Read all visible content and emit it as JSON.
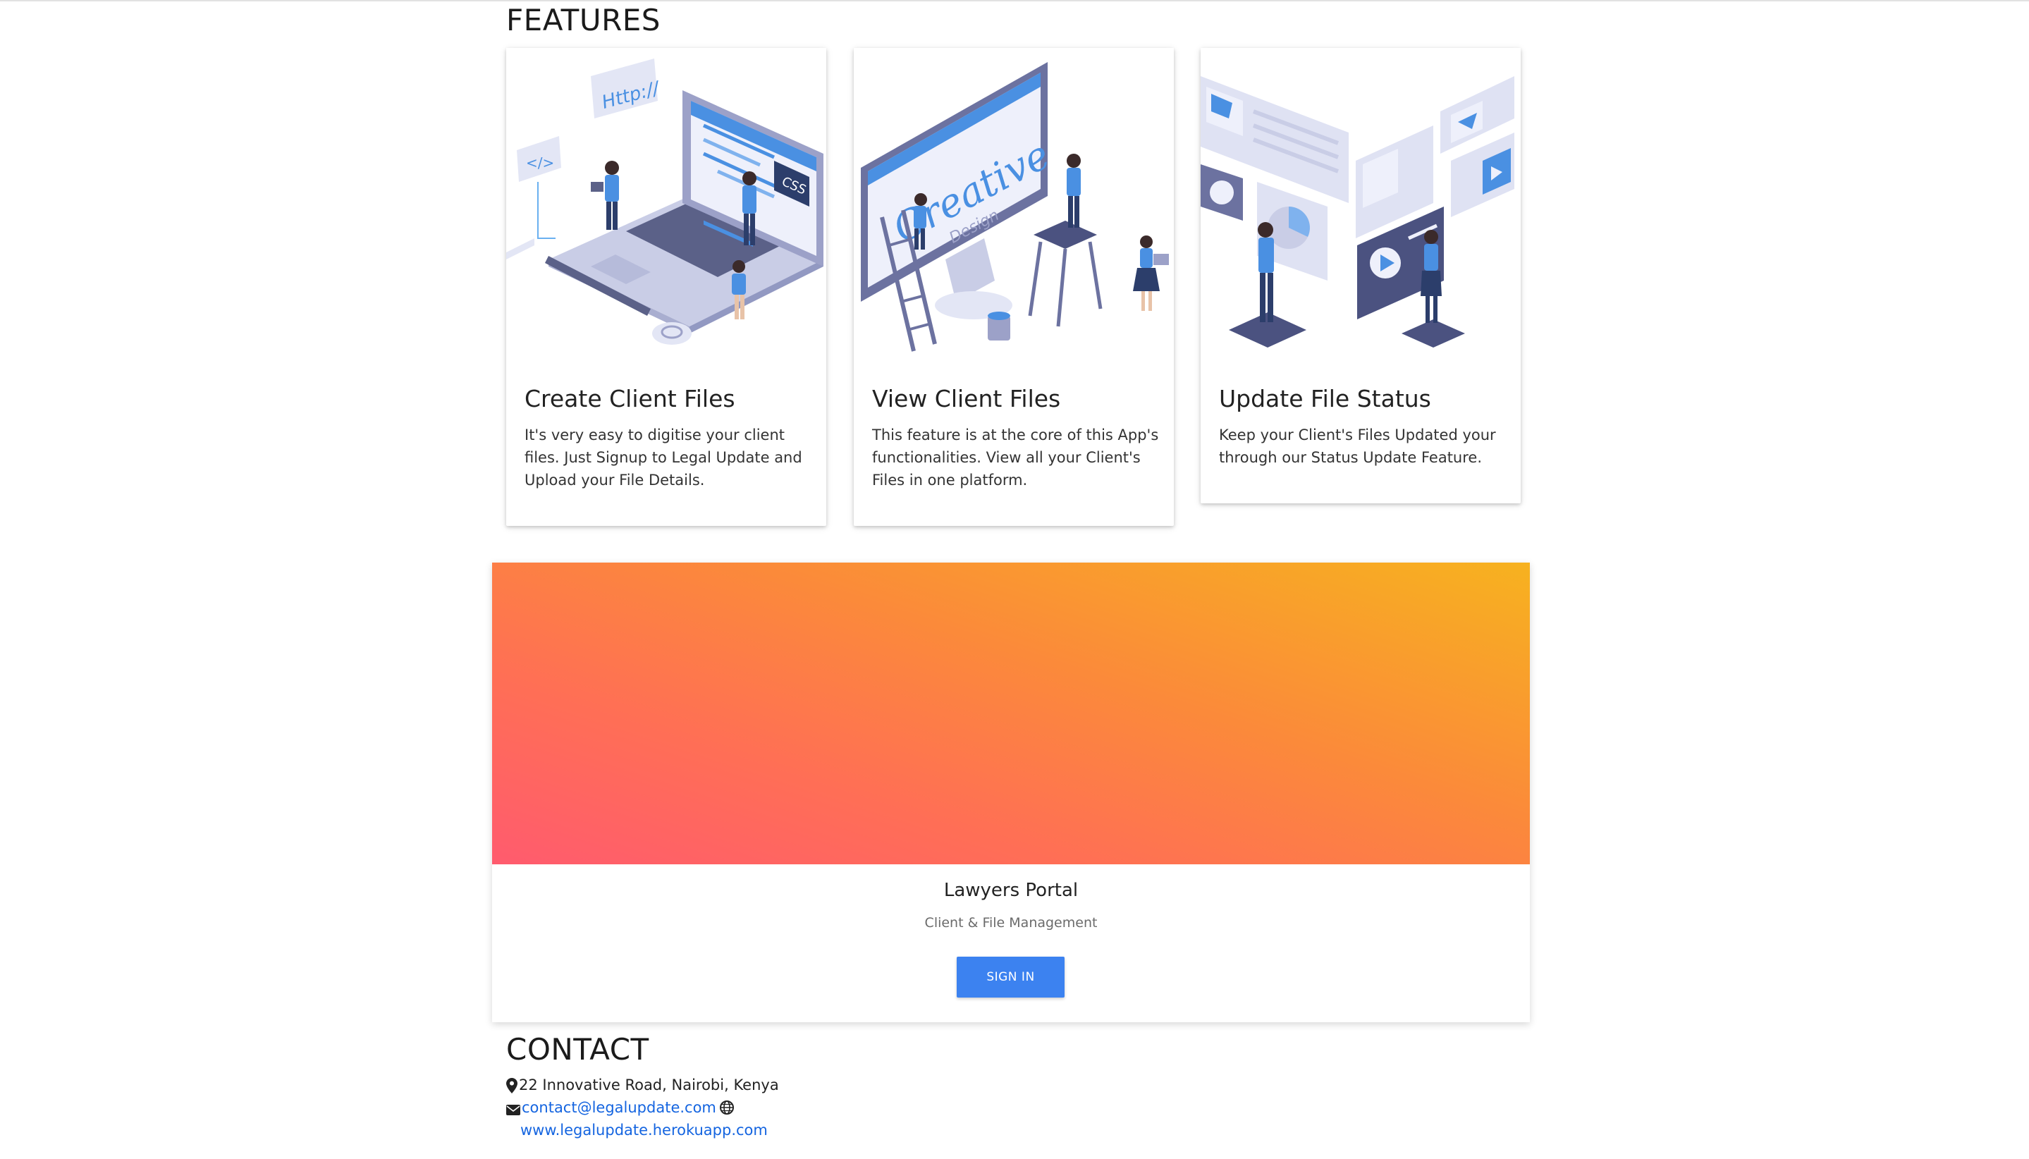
{
  "features": {
    "title": "FEATURES",
    "cards": [
      {
        "title": "Create Client Files",
        "text": "It's very easy to digitise your client files. Just Signup to Legal Update and Upload your File Details.",
        "illustration": "laptop-developers-illustration"
      },
      {
        "title": "View Client Files",
        "text": "This feature is at the core of this App's functionalities. View all your Client's Files in one platform.",
        "illustration": "creative-design-monitor-illustration"
      },
      {
        "title": "Update File Status",
        "text": "Keep your Client's Files Updated your through our Status Update Feature.",
        "illustration": "dashboard-panels-illustration"
      }
    ],
    "illustration_labels": {
      "http": "Http://",
      "css": "CSS",
      "creative": "Creative",
      "design": "Design"
    }
  },
  "portal": {
    "title": "Lawyers Portal",
    "subtitle": "Client & File Management",
    "signin_label": "SIGN IN",
    "gradient_colors": [
      "#f7b21f",
      "#fb8a3a",
      "#ff6f55",
      "#ff5b6e"
    ]
  },
  "contact": {
    "title": "CONTACT",
    "address": "22 Innovative Road, Nairobi, Kenya",
    "email": "contact@legalupdate.com",
    "website": "www.legalupdate.herokuapp.com",
    "icons": [
      "map-marker-icon",
      "envelope-icon",
      "globe-icon"
    ]
  },
  "colors": {
    "accent": "#3c82f0",
    "link": "#1565e0",
    "illustration_blue": "#4a90e2",
    "illustration_navy": "#2c3e6b"
  }
}
